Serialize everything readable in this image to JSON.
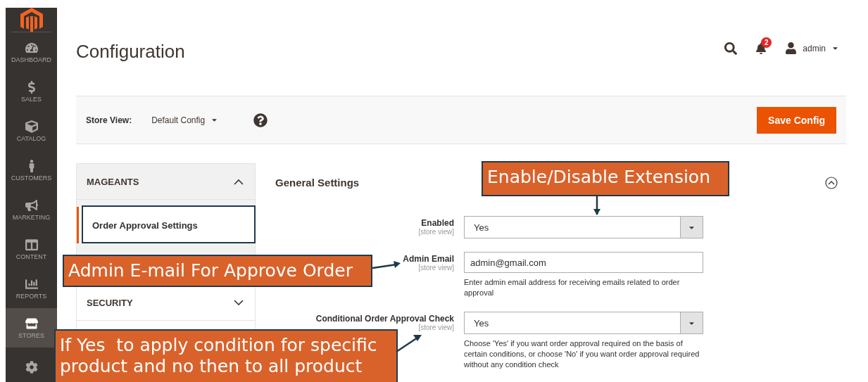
{
  "sidebar": {
    "items": [
      {
        "label": "DASHBOARD",
        "selected": false
      },
      {
        "label": "SALES",
        "selected": false
      },
      {
        "label": "CATALOG",
        "selected": false
      },
      {
        "label": "CUSTOMERS",
        "selected": false
      },
      {
        "label": "MARKETING",
        "selected": false
      },
      {
        "label": "CONTENT",
        "selected": false
      },
      {
        "label": "REPORTS",
        "selected": false
      },
      {
        "label": "STORES",
        "selected": true
      }
    ]
  },
  "header": {
    "title": "Configuration",
    "notification_count": "2",
    "user": "admin"
  },
  "store_bar": {
    "label": "Store View:",
    "value": "Default Config",
    "save_button": "Save Config"
  },
  "config_tabs": [
    {
      "title": "MAGEANTS",
      "expanded": true,
      "items": [
        {
          "label": "Order Approval Settings",
          "selected": true
        }
      ]
    },
    {
      "title": "SECURITY",
      "expanded": false
    }
  ],
  "section": {
    "title": "General Settings",
    "expanded": true,
    "fields": [
      {
        "kind": "select",
        "label": "Enabled",
        "scope": "[store view]",
        "value": "Yes"
      },
      {
        "kind": "text",
        "label": "Admin Email",
        "scope": "[store view]",
        "value": "admin@gmail.com",
        "note": "Enter admin email address for receiving emails related to order approval"
      },
      {
        "kind": "select",
        "label": "Conditional Order Approval Check",
        "scope": "[store view]",
        "value": "Yes",
        "note": "Choose 'Yes' if you want order approval required on the basis of certain conditions, or choose 'No' if you want order approval required without any condition check"
      }
    ]
  },
  "annotations": [
    {
      "text": "Enable/Disable Extension"
    },
    {
      "text": "Admin E-mail For Approve Order"
    },
    {
      "text": "If Yes  to apply condition for specific product and no then to all product"
    }
  ]
}
